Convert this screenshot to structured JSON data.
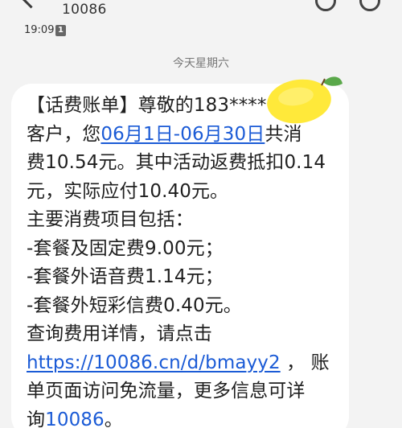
{
  "header": {
    "contact": "10086",
    "back_icon": "back-arrow-icon",
    "action_icons": [
      "call-icon",
      "more-icon"
    ]
  },
  "status": {
    "time": "19:09",
    "sim_badge": "1"
  },
  "date_divider": "今天星期六",
  "message": {
    "line1": "【话费账单】尊敬的183****",
    "line2_pre": "客户，您",
    "line2_link": "06月1日-06月30日",
    "line2_post": "共消",
    "line3": "费10.54元。其中活动返费抵扣0.14",
    "line4": "元，实际应付10.40元。",
    "line5": "主要消费项目包括：",
    "line6": "-套餐及固定费9.00元；",
    "line7": "-套餐外语音费1.14元；",
    "line8": "-套餐外短彩信费0.40元。",
    "line9": "查询费用详情，请点击",
    "line10_link": "https://10086.cn/d/bmayy2",
    "line10_post": " ，  账",
    "line11": "单页面访问免流量，更多信息可详",
    "line12_pre": "询",
    "line12_link": "10086",
    "line12_post": "。"
  },
  "colors": {
    "background": "#f3f3f3",
    "bubble": "#ffffff",
    "link": "#1b5bd6",
    "text": "#1f1f1f",
    "lemon": "#ffe93a"
  }
}
